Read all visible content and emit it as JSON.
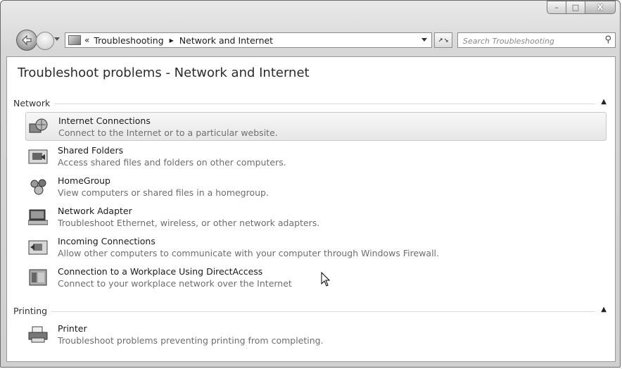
{
  "window": {
    "minimize_glyph": "–",
    "maximize_glyph": "□",
    "close_glyph": "X"
  },
  "nav": {
    "breadcrumb_chevron": "«",
    "breadcrumb": [
      "Troubleshooting",
      "Network and Internet"
    ],
    "breadcrumb_separator": "▶",
    "refresh_glyph": "⁴↲",
    "search_placeholder": "Search Troubleshooting"
  },
  "page": {
    "title": "Troubleshoot problems - Network and Internet"
  },
  "groups": [
    {
      "name": "Network",
      "items": [
        {
          "name": "Internet Connections",
          "desc": "Connect to the Internet or to a particular website.",
          "icon": "internet-connections-icon",
          "selected": true
        },
        {
          "name": "Shared Folders",
          "desc": "Access shared files and folders on other computers.",
          "icon": "shared-folders-icon"
        },
        {
          "name": "HomeGroup",
          "desc": "View computers or shared files in a homegroup.",
          "icon": "homegroup-icon"
        },
        {
          "name": "Network Adapter",
          "desc": "Troubleshoot Ethernet, wireless, or other network adapters.",
          "icon": "network-adapter-icon"
        },
        {
          "name": "Incoming Connections",
          "desc": "Allow other computers to communicate with your computer through Windows Firewall.",
          "icon": "incoming-connections-icon"
        },
        {
          "name": "Connection to a Workplace Using DirectAccess",
          "desc": "Connect to your workplace network over the Internet",
          "icon": "directaccess-icon"
        }
      ]
    },
    {
      "name": "Printing",
      "items": [
        {
          "name": "Printer",
          "desc": "Troubleshoot problems preventing printing from completing.",
          "icon": "printer-icon"
        }
      ]
    }
  ],
  "group_caret": "▲"
}
